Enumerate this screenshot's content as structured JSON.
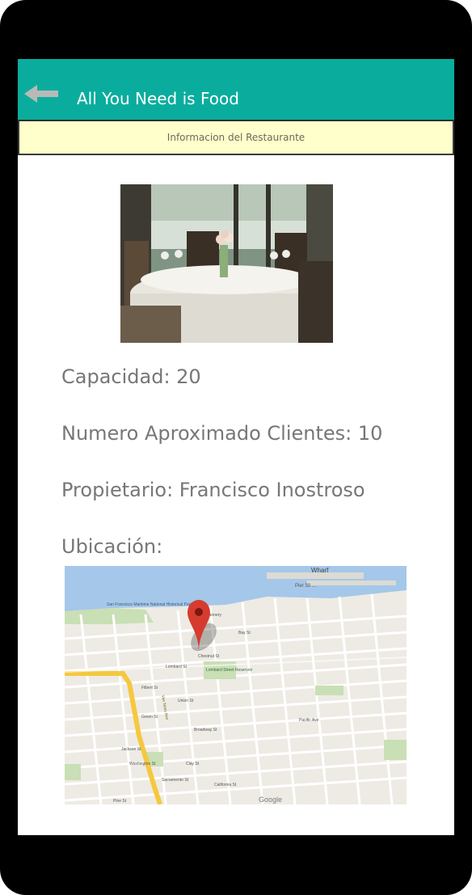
{
  "app": {
    "title": "All You Need is Food",
    "subheader": "Informacion del Restaurante"
  },
  "details": {
    "capacidad": "Capacidad: 20",
    "clientes": "Numero Aproximado Clientes: 10",
    "propietario": "Propietario: Francisco Inostroso",
    "ubicacion": "Ubicación:"
  },
  "map": {
    "labels": {
      "wharf": "Wharf",
      "pier": "Pier 39 ...",
      "maritime": "San Francisco Maritime National Historical Park",
      "cannery": "The Cannery",
      "bay": "Bay St",
      "chestnut": "Chestnut St",
      "lombard": "Lombard St",
      "filbert": "Filbert St",
      "union": "Union St",
      "green": "Green St",
      "broadway": "Broadway St",
      "pacific": "Pacific Ave",
      "jackson": "Jackson St",
      "washington": "Washington St",
      "clay": "Clay St",
      "sacramento": "Sacramento St",
      "california": "California St",
      "pine": "Pine St",
      "reservoir": "Lombard Street Reservoir",
      "vanness": "Van Ness Ave",
      "google": "Google"
    }
  },
  "colors": {
    "appbar": "#0aad9d",
    "subheader": "#ffffcc",
    "text": "#777777",
    "pin": "#d63b2f"
  }
}
